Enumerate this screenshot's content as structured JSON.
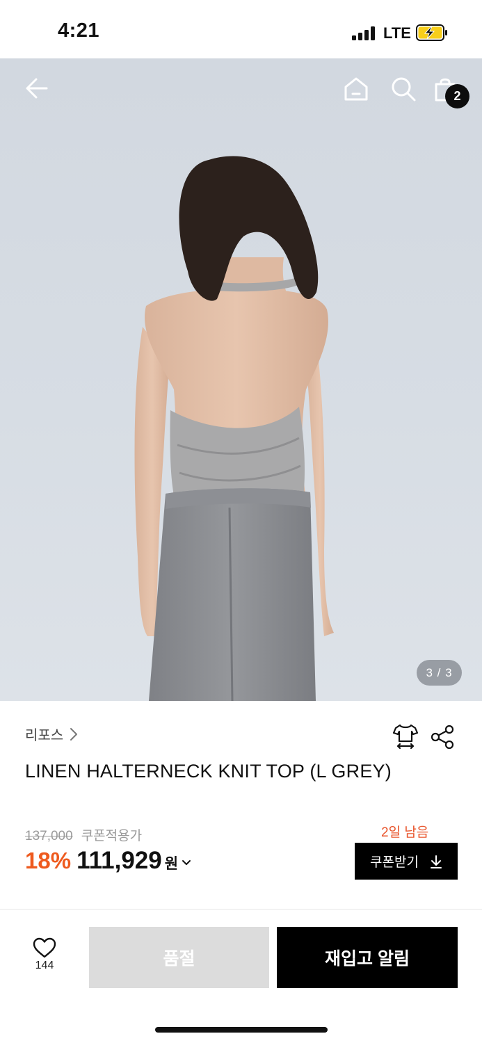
{
  "status_bar": {
    "time": "4:21",
    "network": "LTE",
    "signal_icon": "cell-signal-icon",
    "battery_icon": "battery-charging-icon"
  },
  "header": {
    "back_icon": "arrow-left-icon",
    "home_icon": "home-icon",
    "search_icon": "search-icon",
    "cart_icon": "shopping-bag-icon",
    "cart_count": "2"
  },
  "gallery": {
    "page_indicator": "3 / 3"
  },
  "product": {
    "brand": "리포스",
    "brand_chevron_icon": "chevron-right-icon",
    "size_guide_icon": "tshirt-size-icon",
    "share_icon": "share-icon",
    "name": "LINEN HALTERNECK KNIT TOP (L GREY)"
  },
  "pricing": {
    "original_price": "137,000",
    "coupon_label": "쿠폰적용가",
    "discount": "18%",
    "price": "111,929",
    "currency": "원",
    "days_left": "2일 남음",
    "coupon_button": "쿠폰받기"
  },
  "bottom_bar": {
    "like_icon": "heart-icon",
    "like_count": "144",
    "soldout_label": "품절",
    "restock_label": "재입고 알림"
  },
  "colors": {
    "accent_orange": "#ee5a1e",
    "days_red": "#e8532a",
    "button_black": "#000000",
    "disabled_grey": "#dcdcdc"
  }
}
